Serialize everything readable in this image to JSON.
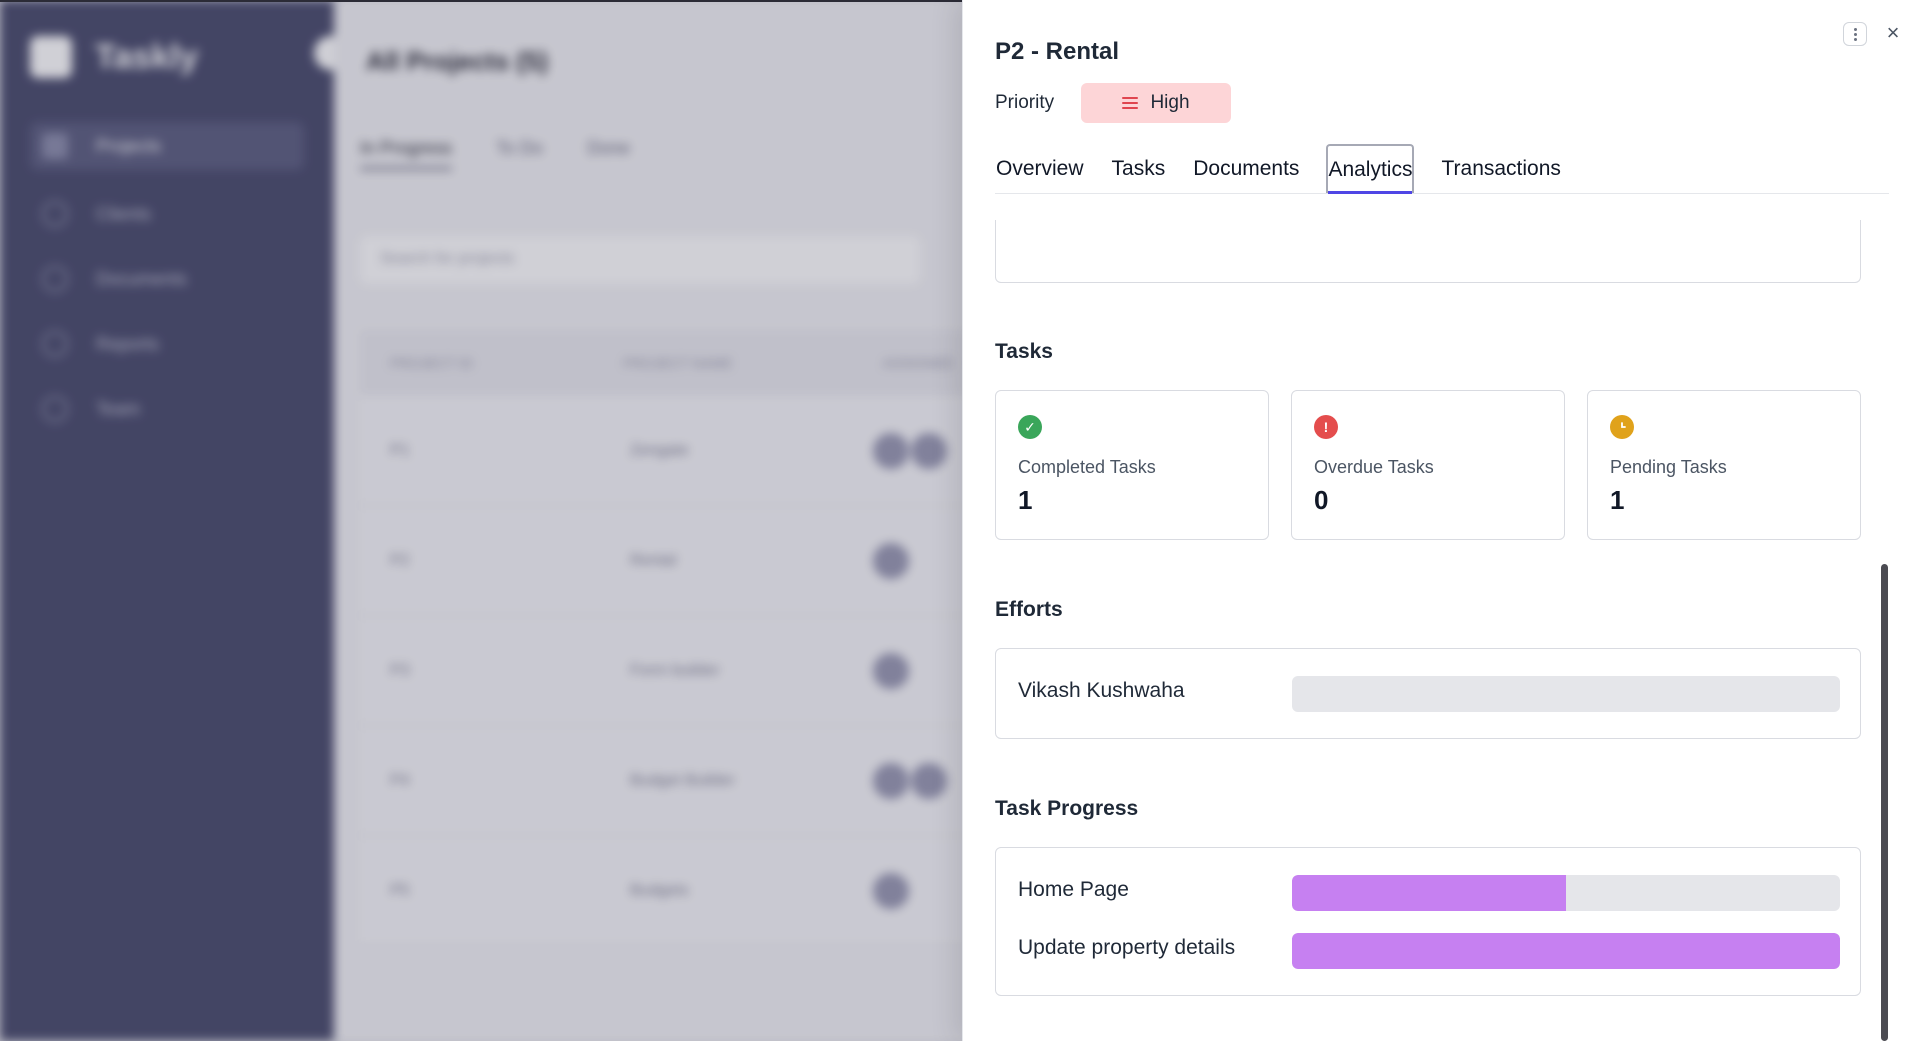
{
  "background": {
    "brand": "Taskly",
    "page_title": "All Projects (5)",
    "tabs": [
      "In Progress",
      "To Do",
      "Done"
    ],
    "search_placeholder": "Search for projects",
    "nav": [
      "Projects",
      "Clients",
      "Documents",
      "Reports",
      "Team"
    ],
    "table_headers": [
      "PROJECT ID",
      "PROJECT NAME",
      "ASSIGNEE"
    ],
    "rows": [
      {
        "id": "P1",
        "name": "Zengate"
      },
      {
        "id": "P2",
        "name": "Rental"
      },
      {
        "id": "P3",
        "name": "Form builder"
      },
      {
        "id": "P4",
        "name": "Budget Builder"
      },
      {
        "id": "P5",
        "name": "Budgets"
      }
    ]
  },
  "drawer": {
    "title": "P2 - Rental",
    "priority_label": "Priority",
    "priority_value": "High",
    "tabs": [
      "Overview",
      "Tasks",
      "Documents",
      "Analytics",
      "Transactions"
    ],
    "active_tab": "Analytics"
  },
  "tasks": {
    "title": "Tasks",
    "completed": {
      "label": "Completed Tasks",
      "value": "1",
      "color": "#3aa65a"
    },
    "overdue": {
      "label": "Overdue Tasks",
      "value": "0",
      "color": "#e44d4d"
    },
    "pending": {
      "label": "Pending Tasks",
      "value": "1",
      "color": "#e0a21b"
    }
  },
  "efforts": {
    "title": "Efforts",
    "items": [
      {
        "name": "Vikash Kushwaha",
        "fraction": 0
      }
    ]
  },
  "task_progress": {
    "title": "Task Progress",
    "items": [
      {
        "name": "Home Page",
        "fraction": 0.5
      },
      {
        "name": "Update property details",
        "fraction": 1.0
      }
    ]
  },
  "colors": {
    "accent": "#4f46e5",
    "progress": "#c680f1",
    "priority_high_bg": "#fdd5d7",
    "priority_high_icon": "#e0454f"
  }
}
